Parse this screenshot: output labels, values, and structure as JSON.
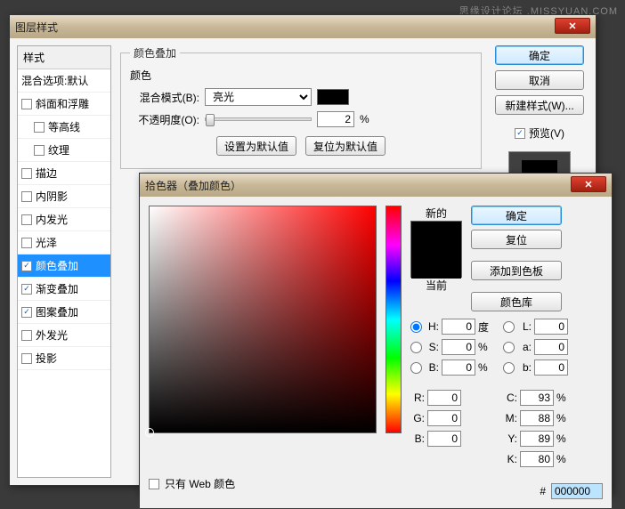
{
  "watermark": "思缘设计论坛 .MISSYUAN.COM",
  "layerStyles": {
    "title": "图层样式",
    "styles_header": "样式",
    "blend_defaults": "混合选项:默认",
    "items": [
      {
        "label": "斜面和浮雕",
        "checked": false,
        "sub": false
      },
      {
        "label": "等高线",
        "checked": false,
        "sub": true
      },
      {
        "label": "纹理",
        "checked": false,
        "sub": true
      },
      {
        "label": "描边",
        "checked": false,
        "sub": false
      },
      {
        "label": "内阴影",
        "checked": false,
        "sub": false
      },
      {
        "label": "内发光",
        "checked": false,
        "sub": false
      },
      {
        "label": "光泽",
        "checked": false,
        "sub": false
      },
      {
        "label": "颜色叠加",
        "checked": true,
        "sub": false,
        "selected": true
      },
      {
        "label": "渐变叠加",
        "checked": true,
        "sub": false
      },
      {
        "label": "图案叠加",
        "checked": true,
        "sub": false
      },
      {
        "label": "外发光",
        "checked": false,
        "sub": false
      },
      {
        "label": "投影",
        "checked": false,
        "sub": false
      }
    ],
    "panel_title": "颜色叠加",
    "panel_sub": "颜色",
    "blend_mode_label": "混合模式(B):",
    "blend_mode_value": "亮光",
    "opacity_label": "不透明度(O):",
    "opacity_value": "2",
    "opacity_unit": "%",
    "set_default_btn": "设置为默认值",
    "reset_default_btn": "复位为默认值",
    "ok": "确定",
    "cancel": "取消",
    "new_style": "新建样式(W)...",
    "preview_label": "预览(V)",
    "preview_checked": true
  },
  "colorPicker": {
    "title": "拾色器（叠加颜色）",
    "new_label": "新的",
    "current_label": "当前",
    "ok": "确定",
    "reset": "复位",
    "add_swatch": "添加到色板",
    "color_lib": "颜色库",
    "only_web": "只有 Web 颜色",
    "hex_label": "#",
    "hex_value": "000000",
    "H": {
      "lbl": "H:",
      "val": "0",
      "unit": "度"
    },
    "S": {
      "lbl": "S:",
      "val": "0",
      "unit": "%"
    },
    "Bv": {
      "lbl": "B:",
      "val": "0",
      "unit": "%"
    },
    "L": {
      "lbl": "L:",
      "val": "0"
    },
    "a": {
      "lbl": "a:",
      "val": "0"
    },
    "b": {
      "lbl": "b:",
      "val": "0"
    },
    "R": {
      "lbl": "R:",
      "val": "0"
    },
    "G": {
      "lbl": "G:",
      "val": "0"
    },
    "Bc": {
      "lbl": "B:",
      "val": "0"
    },
    "C": {
      "lbl": "C:",
      "val": "93",
      "unit": "%"
    },
    "M": {
      "lbl": "M:",
      "val": "88",
      "unit": "%"
    },
    "Y": {
      "lbl": "Y:",
      "val": "89",
      "unit": "%"
    },
    "K": {
      "lbl": "K:",
      "val": "80",
      "unit": "%"
    }
  }
}
